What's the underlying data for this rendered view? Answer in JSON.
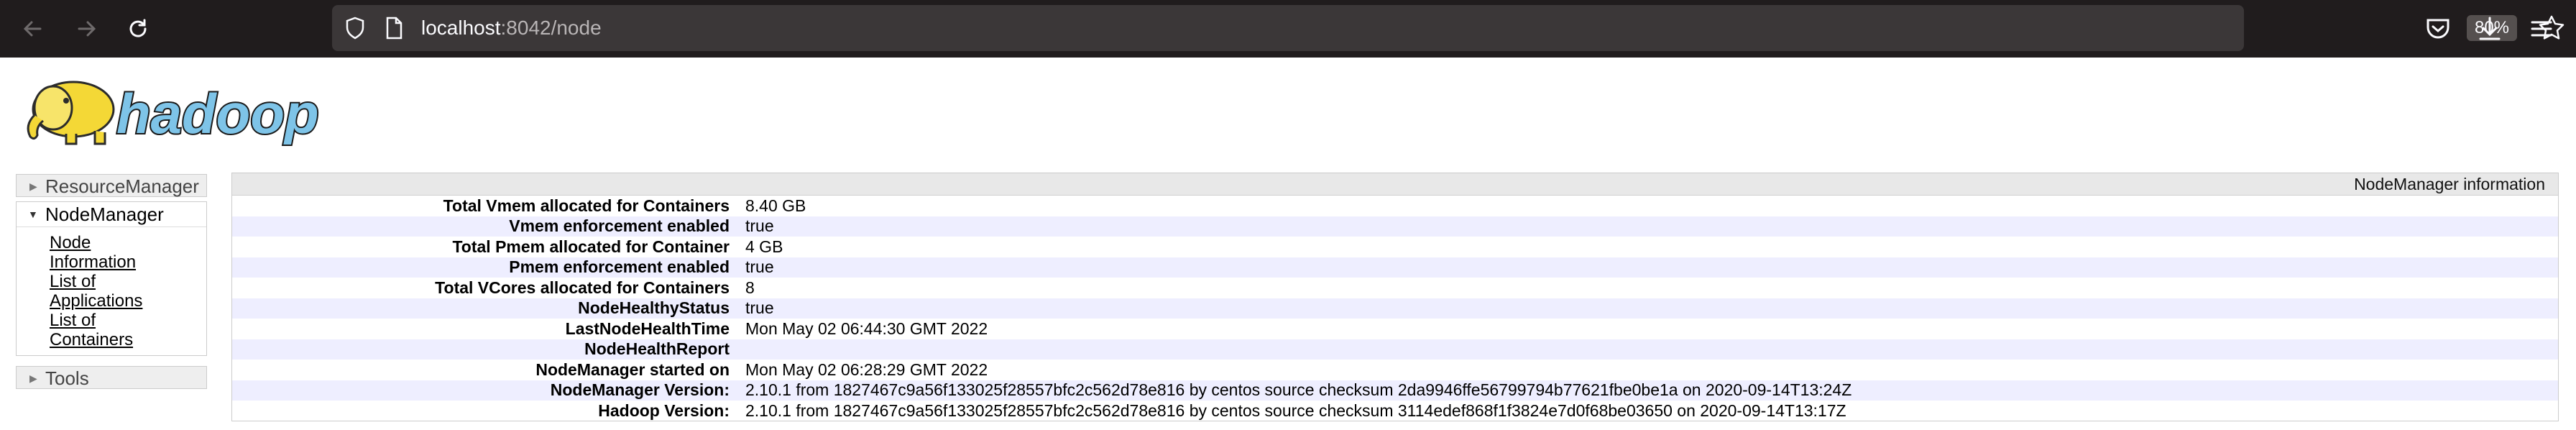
{
  "browser": {
    "url_host": "localhost",
    "url_rest": ":8042/node",
    "zoom": "80%",
    "icons": [
      "back-arrow-icon",
      "forward-arrow-icon",
      "reload-icon",
      "shield-icon",
      "page-icon",
      "star-icon",
      "pocket-icon",
      "download-icon",
      "menu-icon"
    ]
  },
  "logo": {
    "text": "hadoop"
  },
  "sidebar": {
    "resource_manager": "ResourceManager",
    "node_manager": "NodeManager",
    "links": [
      "Node Information",
      "List of Applications",
      "List of Containers"
    ],
    "tools": "Tools"
  },
  "info": {
    "header": "NodeManager information",
    "rows": [
      {
        "key": "Total Vmem allocated for Containers",
        "value": "8.40 GB"
      },
      {
        "key": "Vmem enforcement enabled",
        "value": "true"
      },
      {
        "key": "Total Pmem allocated for Container",
        "value": "4 GB"
      },
      {
        "key": "Pmem enforcement enabled",
        "value": "true"
      },
      {
        "key": "Total VCores allocated for Containers",
        "value": "8"
      },
      {
        "key": "NodeHealthyStatus",
        "value": "true"
      },
      {
        "key": "LastNodeHealthTime",
        "value": "Mon May 02 06:44:30 GMT 2022"
      },
      {
        "key": "NodeHealthReport",
        "value": ""
      },
      {
        "key": "NodeManager started on",
        "value": "Mon May 02 06:28:29 GMT 2022"
      },
      {
        "key": "NodeManager Version:",
        "value": "2.10.1 from 1827467c9a56f133025f28557bfc2c562d78e816 by centos source checksum 2da9946ffe56799794b77621fbe0be1a on 2020-09-14T13:24Z"
      },
      {
        "key": "Hadoop Version:",
        "value": "2.10.1 from 1827467c9a56f133025f28557bfc2c562d78e816 by centos source checksum 3114edef868f1f3824e7d0f68be03650 on 2020-09-14T13:17Z"
      }
    ]
  }
}
